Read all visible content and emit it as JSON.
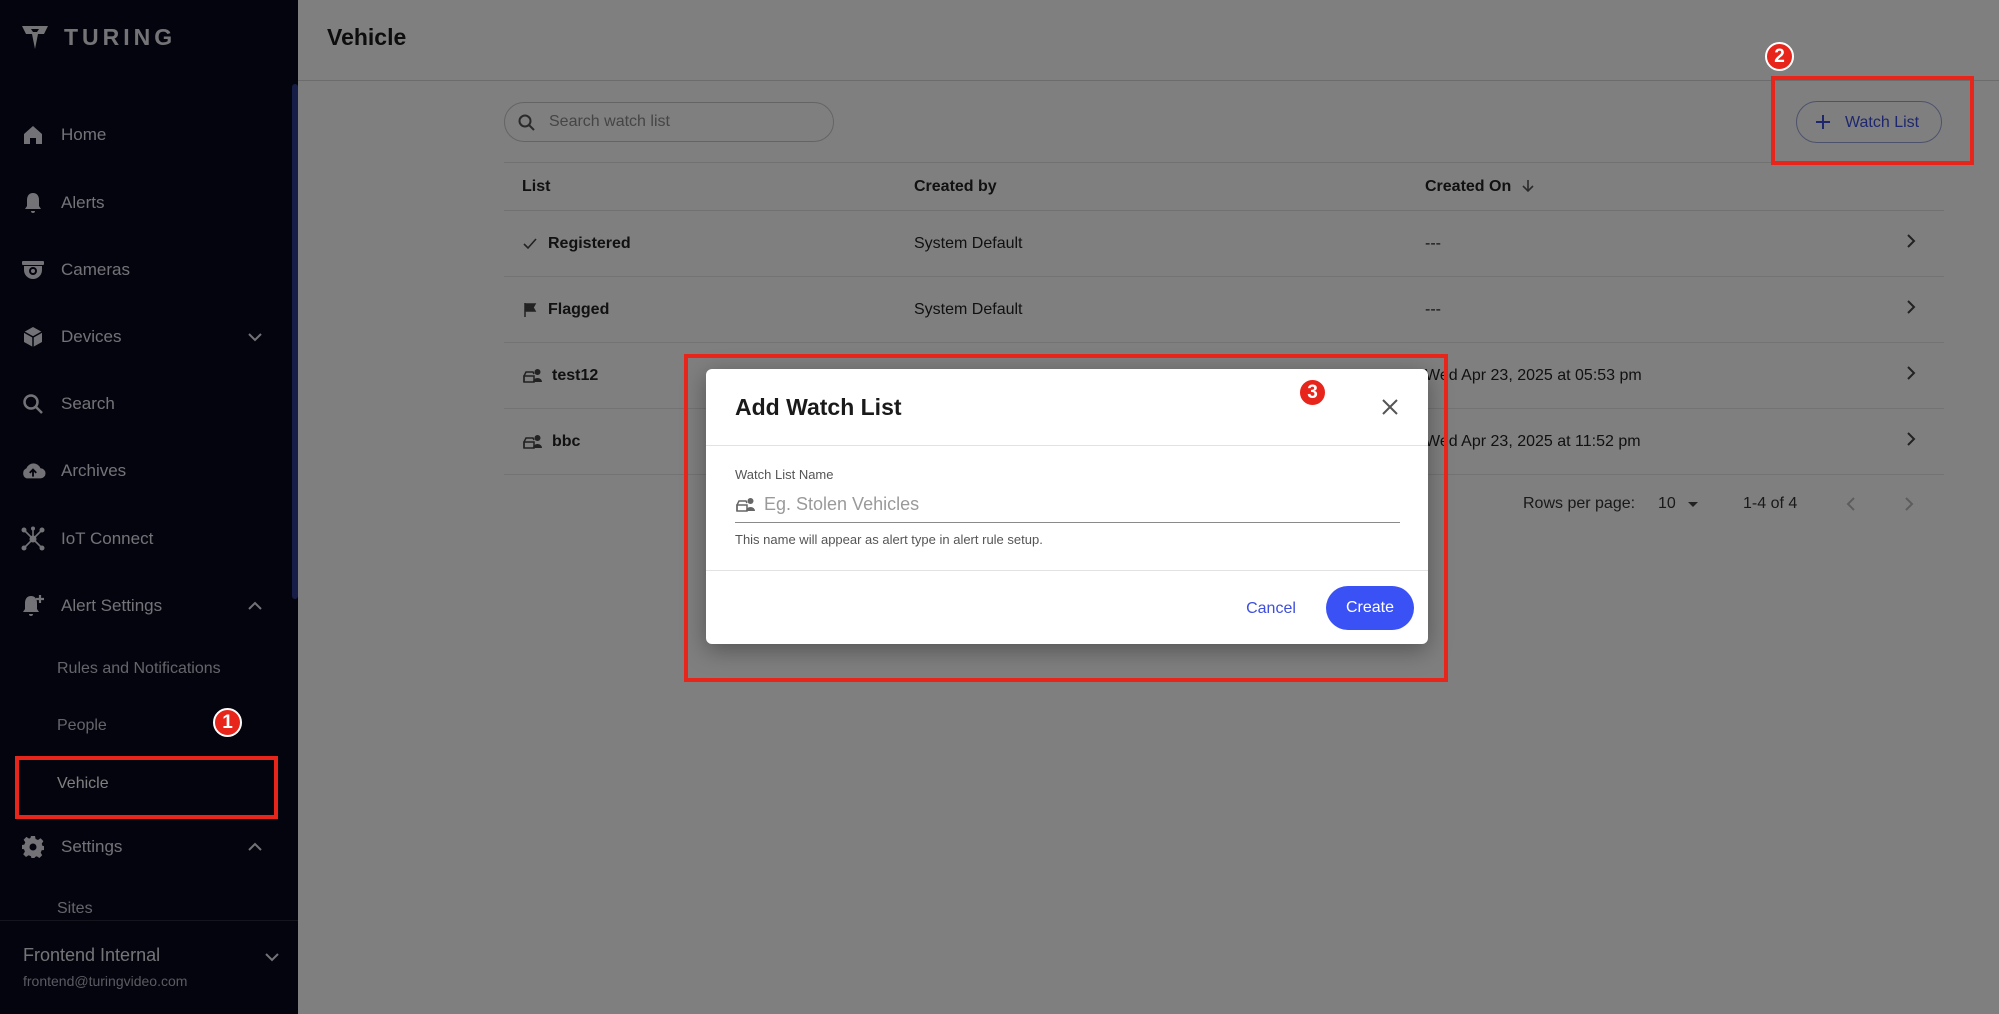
{
  "brand": {
    "name": "TURING"
  },
  "sidebar": {
    "items": [
      {
        "label": "Home",
        "icon": "home-icon"
      },
      {
        "label": "Alerts",
        "icon": "bell-icon"
      },
      {
        "label": "Cameras",
        "icon": "camera-icon"
      },
      {
        "label": "Devices",
        "icon": "device-icon"
      },
      {
        "label": "Search",
        "icon": "search-icon"
      },
      {
        "label": "Archives",
        "icon": "cloud-upload-icon"
      },
      {
        "label": "IoT Connect",
        "icon": "hub-icon"
      },
      {
        "label": "Alert Settings",
        "icon": "bell-plus-icon"
      },
      {
        "label": "Settings",
        "icon": "gear-icon"
      }
    ],
    "alert_settings_sub": [
      "Rules and Notifications",
      "People",
      "Vehicle"
    ],
    "settings_sub": [
      "Sites"
    ],
    "active": "Vehicle",
    "account": {
      "name": "Frontend Internal",
      "email": "frontend@turingvideo.com"
    }
  },
  "main": {
    "title": "Vehicle",
    "search": {
      "placeholder": "Search watch list"
    },
    "add_button": {
      "label": "Watch List"
    },
    "table": {
      "columns": [
        "List",
        "Created by",
        "Created On"
      ],
      "rows": [
        {
          "name": "Registered",
          "icon": "check-icon",
          "created_by": "System Default",
          "created_on": "---"
        },
        {
          "name": "Flagged",
          "icon": "flag-icon",
          "created_by": "System Default",
          "created_on": "---"
        },
        {
          "name": "test12",
          "icon": "vehicle-list-icon",
          "created_by": "",
          "created_on": "Wed Apr 23, 2025 at 05:53 pm"
        },
        {
          "name": "bbc",
          "icon": "vehicle-list-icon",
          "created_by": "",
          "created_on": "Wed Apr 23, 2025 at 11:52 pm"
        }
      ]
    },
    "pagination": {
      "rows_per_page_label": "Rows per page:",
      "rows_per_page": "10",
      "range": "1-4 of 4"
    }
  },
  "dialog": {
    "title": "Add Watch List",
    "field_label": "Watch List Name",
    "field_placeholder": "Eg. Stolen Vehicles",
    "helper": "This name will appear as alert type in alert rule setup.",
    "cancel": "Cancel",
    "create": "Create"
  },
  "annotations": [
    "1",
    "2",
    "3"
  ],
  "colors": {
    "accent": "#3a51f5",
    "annotation": "#e8251b",
    "sidebar_bg": "#07081a"
  }
}
